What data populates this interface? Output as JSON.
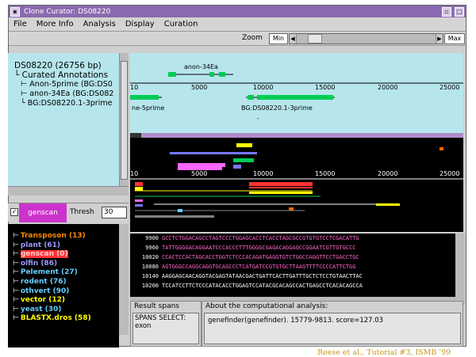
{
  "window": {
    "title": "Clone Curator: DS08220"
  },
  "menu": [
    "File",
    "More Info",
    "Analysis",
    "Display",
    "Curation"
  ],
  "zoom": {
    "label": "Zoom",
    "min": "Min",
    "max": "Max",
    "level": 0.08
  },
  "tree": {
    "root": "DS08220 (26756 bp)",
    "group": "Curated Annotations",
    "items": [
      "Anon-5prime (BG:DS0",
      "anon-34Ea (BG:DS082",
      "BG:DS08220.1-3prime"
    ]
  },
  "genome": {
    "ticks": [
      "10",
      "5000",
      "10000",
      "15000",
      "20000",
      "25000"
    ],
    "gene_labels": [
      "anon-34Ea",
      "ne-5prime",
      "BG:DS08220.1-3prime"
    ],
    "dash_mark": "-"
  },
  "genescan": {
    "checkbox": "✓",
    "name": "genscan",
    "threshold_label": "Thresh",
    "threshold_value": "30"
  },
  "evidence": [
    {
      "label": "Transposon (13)",
      "color": "#ff8800"
    },
    {
      "label": "plant (61)",
      "color": "#9999ff"
    },
    {
      "label": "genscan (0)",
      "color": "#ff4444",
      "highlight": true
    },
    {
      "label": "olfin (86)",
      "color": "#9999ff"
    },
    {
      "label": "Pelement (27)",
      "color": "#66ccff"
    },
    {
      "label": "rodent (76)",
      "color": "#66ccff"
    },
    {
      "label": "othvert (90)",
      "color": "#66ccff"
    },
    {
      "label": "vector (12)",
      "color": "#ffff00"
    },
    {
      "label": "yeast (30)",
      "color": "#66ccff"
    },
    {
      "label": "BLASTX.dros (58)",
      "color": "#ffff00"
    }
  ],
  "sequence": [
    {
      "pos": "9900",
      "bases": "GCCTCTGGACAGCCTAGTCCCTGGAGCACCTCACCTAGCGCCGTGTGTCCTCGACATTG",
      "color": "#ff66cc"
    },
    {
      "pos": "9960",
      "bases": "TATTGGGGACAGGAATCCCACCCTTTGGGGCGAGACAGGAGCCGGAATCGTTGTGCCC",
      "color": "#ff66cc"
    },
    {
      "pos": "10020",
      "bases": "CCACTCCACTAGCACCTGGTCTCCCACAGATGAGGTGTCTGGCCAGGTTCCTGACCTGC",
      "color": "#ff66cc"
    },
    {
      "pos": "10080",
      "bases": "AGTGGGCCAGGCAGGTGCAGCCCTCATGATCCGTGTGCTTAAGTTTTCCCCATTCTGG",
      "color": "#ff66cc"
    },
    {
      "pos": "10140",
      "bases": "AAGGAGCAACAGGTACGAGTATAACGACTGATTCACTTGATTTGCTCTCCTGTAACTTAC",
      "color": "#ffffff"
    },
    {
      "pos": "10200",
      "bases": "TCCATCCTTCTCCCATACACCTGGAGTCCATACGCACAGCCACTGAGCCTCACACAGCCA",
      "color": "#ffffff"
    }
  ],
  "results": {
    "label": "Result spans",
    "text": "SPANS SELECT: exon"
  },
  "about": {
    "label": "About the computational analysis:",
    "text": "genefinder(genefinder). 15779-9813. score=127.03"
  },
  "credit": "Reese et al., Tutorial #3, ISMB '99"
}
